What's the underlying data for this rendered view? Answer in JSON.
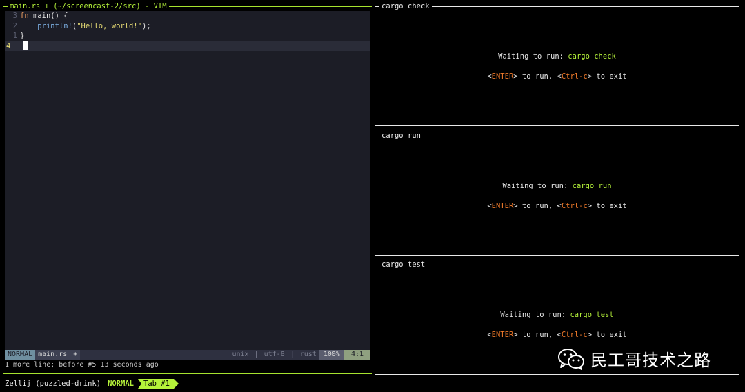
{
  "vim": {
    "title": "main.rs + (~/screencast-2/src) - VIM",
    "lines": [
      {
        "num": "3",
        "kw": "fn",
        "rest": " main() {"
      },
      {
        "num": "2",
        "indent": "    ",
        "macro": "println!",
        "paren_open": "(",
        "str": "\"Hello, world!\"",
        "paren_close": ");"
      },
      {
        "num": "1",
        "text": "}"
      },
      {
        "num": "4",
        "text": ""
      }
    ],
    "status": {
      "mode": "NORMAL",
      "file": "main.rs",
      "modified_flag": "+",
      "fileformat": "unix",
      "encoding": "utf-8",
      "filetype": "rust",
      "percent": "100%",
      "position": "4:1"
    },
    "cmdline": "1 more line; before #5  13 seconds ago"
  },
  "panes": {
    "check": {
      "title": "cargo check",
      "waiting_label": "Waiting to run: ",
      "command": "cargo check"
    },
    "run": {
      "title": "cargo run",
      "waiting_label": "Waiting to run: ",
      "command": "cargo run"
    },
    "test": {
      "title": "cargo test",
      "waiting_label": "Waiting to run: ",
      "command": "cargo test"
    },
    "hint": {
      "lt": "<",
      "enter": "ENTER",
      "gt_run": "> to run, ",
      "ctrl": "Ctrl-c",
      "gt_exit": "> to exit"
    }
  },
  "watermark": {
    "icon": "wechat-icon",
    "text": "民工哥技术之路"
  },
  "bottombar": {
    "session": "Zellij (puzzled-drink)",
    "mode": "NORMAL",
    "tab": "Tab #1"
  },
  "colors": {
    "accent": "#b5f23a",
    "orange": "#f07a2a",
    "editor_bg": "#1c1d26"
  }
}
